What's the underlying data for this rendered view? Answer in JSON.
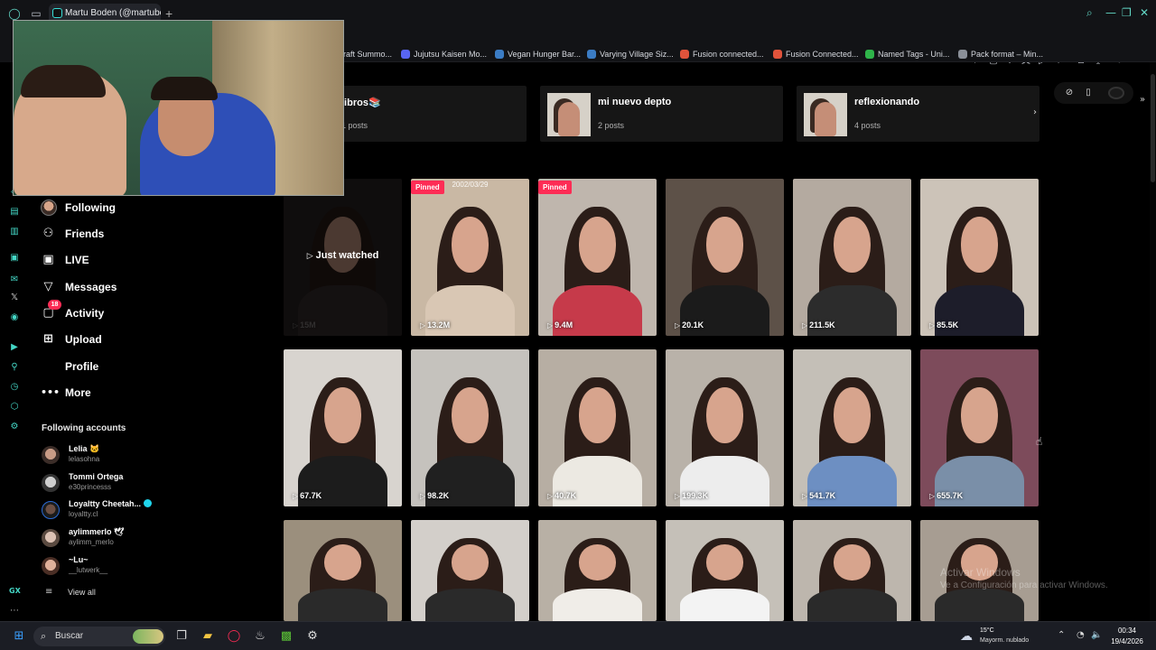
{
  "browser": {
    "tab_title": "Martu Boden (@martubode",
    "new_tab": "+",
    "bookmarks": [
      {
        "label": "raft Summo...",
        "color": "#1a1a1a"
      },
      {
        "label": "Jujutsu Kaisen Mo...",
        "color": "#5865f2"
      },
      {
        "label": "Vegan Hunger Bar...",
        "color": "#3b7cc4"
      },
      {
        "label": "Varying Village Siz...",
        "color": "#3b7cc4"
      },
      {
        "label": "Fusion connected...",
        "color": "#e0533b"
      },
      {
        "label": "Fusion Connected...",
        "color": "#e0533b"
      },
      {
        "label": "Named Tags - Uni...",
        "color": "#2fb44a"
      },
      {
        "label": "Pack format – Min...",
        "color": "#8a8f98"
      }
    ],
    "accent": "#62d7c5"
  },
  "sidebar": {
    "nav": [
      {
        "label": "Following",
        "icon": "following-avatar-icon"
      },
      {
        "label": "Friends",
        "icon": "friends-icon"
      },
      {
        "label": "LIVE",
        "icon": "live-icon"
      },
      {
        "label": "Messages",
        "icon": "messages-icon"
      },
      {
        "label": "Activity",
        "icon": "activity-icon",
        "badge": "18"
      },
      {
        "label": "Upload",
        "icon": "upload-icon"
      },
      {
        "label": "Profile",
        "icon": "profile-icon"
      },
      {
        "label": "More",
        "icon": "more-icon"
      }
    ],
    "following_title": "Following accounts",
    "accounts": [
      {
        "name": "Lelia 🐱",
        "handle": "lelasohna"
      },
      {
        "name": "Tommi Ortega",
        "handle": "e30princesss"
      },
      {
        "name": "Loyaltty Cheetah...",
        "handle": "loyaltty.cl",
        "verified": true
      },
      {
        "name": "aylimmerlo 🕊",
        "handle": "aylimm_merlo"
      },
      {
        "name": "~Lu~",
        "handle": "__lutwerk__"
      }
    ],
    "view_all": "View all"
  },
  "collections": [
    {
      "title": "libros📚",
      "count": "1 posts"
    },
    {
      "title": "mi nuevo depto",
      "count": "2 posts"
    },
    {
      "title": "reflexionando",
      "count": "4 posts"
    }
  ],
  "videos": {
    "just_watched": "Just watched",
    "pinned_label": "Pinned",
    "row1": [
      {
        "views": "15M",
        "bg": "#2a2424",
        "shirt": "#3a3030",
        "dim": true
      },
      {
        "views": "13.2M",
        "bg": "#c9b8a4",
        "shirt": "#d9c7b4",
        "pinned": true,
        "caption": "2002/03/29"
      },
      {
        "views": "9.4M",
        "bg": "#bfb6ad",
        "shirt": "#c63a4a",
        "pinned": true
      },
      {
        "views": "20.1K",
        "bg": "#5d5148",
        "shirt": "#1b1b1b"
      },
      {
        "views": "211.5K",
        "bg": "#b4aaa0",
        "shirt": "#2c2c2c"
      },
      {
        "views": "85.5K",
        "bg": "#ccc3b8",
        "shirt": "#1d1d2a"
      }
    ],
    "row2": [
      {
        "views": "67.7K",
        "bg": "#d8d4cf",
        "shirt": "#1c1c1c"
      },
      {
        "views": "98.2K",
        "bg": "#c5c2bd",
        "shirt": "#202020"
      },
      {
        "views": "40.7K",
        "bg": "#b7aea3",
        "shirt": "#ece9e2"
      },
      {
        "views": "199.3K",
        "bg": "#b9b2a9",
        "shirt": "#ededed"
      },
      {
        "views": "541.7K",
        "bg": "#c4bfb7",
        "shirt": "#6d8fc2"
      },
      {
        "views": "655.7K",
        "bg": "#7d4b5b",
        "shirt": "#7a8fa8"
      }
    ],
    "row3": [
      {
        "bg": "#9b8f7d",
        "shirt": "#2a2a2a"
      },
      {
        "bg": "#d3cfca",
        "shirt": "#2a2a2a"
      },
      {
        "bg": "#b8b0a5",
        "shirt": "#f0ede8"
      },
      {
        "bg": "#c5c0b8",
        "shirt": "#f3f3f3"
      },
      {
        "bg": "#bdb6ad",
        "shirt": "#2a2a2a"
      },
      {
        "bg": "#a79d92",
        "shirt": "#2a2a2a"
      }
    ]
  },
  "watermark": {
    "line1": "Activar Windows",
    "line2": "Ve a Configuración para activar Windows."
  },
  "taskbar": {
    "search_placeholder": "Buscar",
    "weather_temp": "15°C",
    "weather_desc": "Mayorm. nublado",
    "time": "00:34",
    "date": "19/4/2026"
  }
}
